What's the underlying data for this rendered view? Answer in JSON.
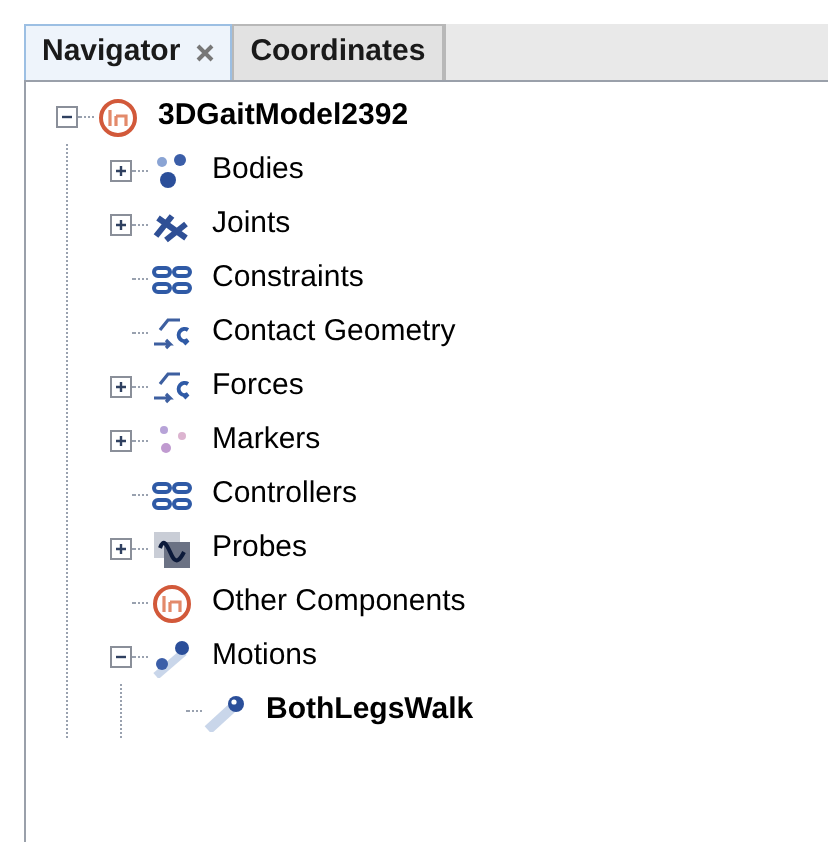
{
  "tabs": [
    {
      "label": "Navigator",
      "selected": true
    },
    {
      "label": "Coordinates",
      "selected": false
    }
  ],
  "tree": {
    "label": "3DGaitModel2392",
    "kind": "model",
    "bold": true,
    "expanded": true,
    "children": [
      {
        "label": "Bodies",
        "kind": "bodies",
        "bold": false,
        "expanded": false,
        "has_children": true
      },
      {
        "label": "Joints",
        "kind": "joints",
        "bold": false,
        "expanded": false,
        "has_children": true
      },
      {
        "label": "Constraints",
        "kind": "links",
        "bold": false,
        "has_children": false
      },
      {
        "label": "Contact Geometry",
        "kind": "forces",
        "bold": false,
        "has_children": false
      },
      {
        "label": "Forces",
        "kind": "forces",
        "bold": false,
        "expanded": false,
        "has_children": true
      },
      {
        "label": "Markers",
        "kind": "markers",
        "bold": false,
        "expanded": false,
        "has_children": true
      },
      {
        "label": "Controllers",
        "kind": "links",
        "bold": false,
        "has_children": false
      },
      {
        "label": "Probes",
        "kind": "probes",
        "bold": false,
        "expanded": false,
        "has_children": true
      },
      {
        "label": "Other Components",
        "kind": "model",
        "bold": false,
        "has_children": false
      },
      {
        "label": "Motions",
        "kind": "motions",
        "bold": false,
        "expanded": true,
        "has_children": true,
        "children": [
          {
            "label": "BothLegsWalk",
            "kind": "motion",
            "bold": true,
            "has_children": false
          }
        ]
      }
    ]
  }
}
